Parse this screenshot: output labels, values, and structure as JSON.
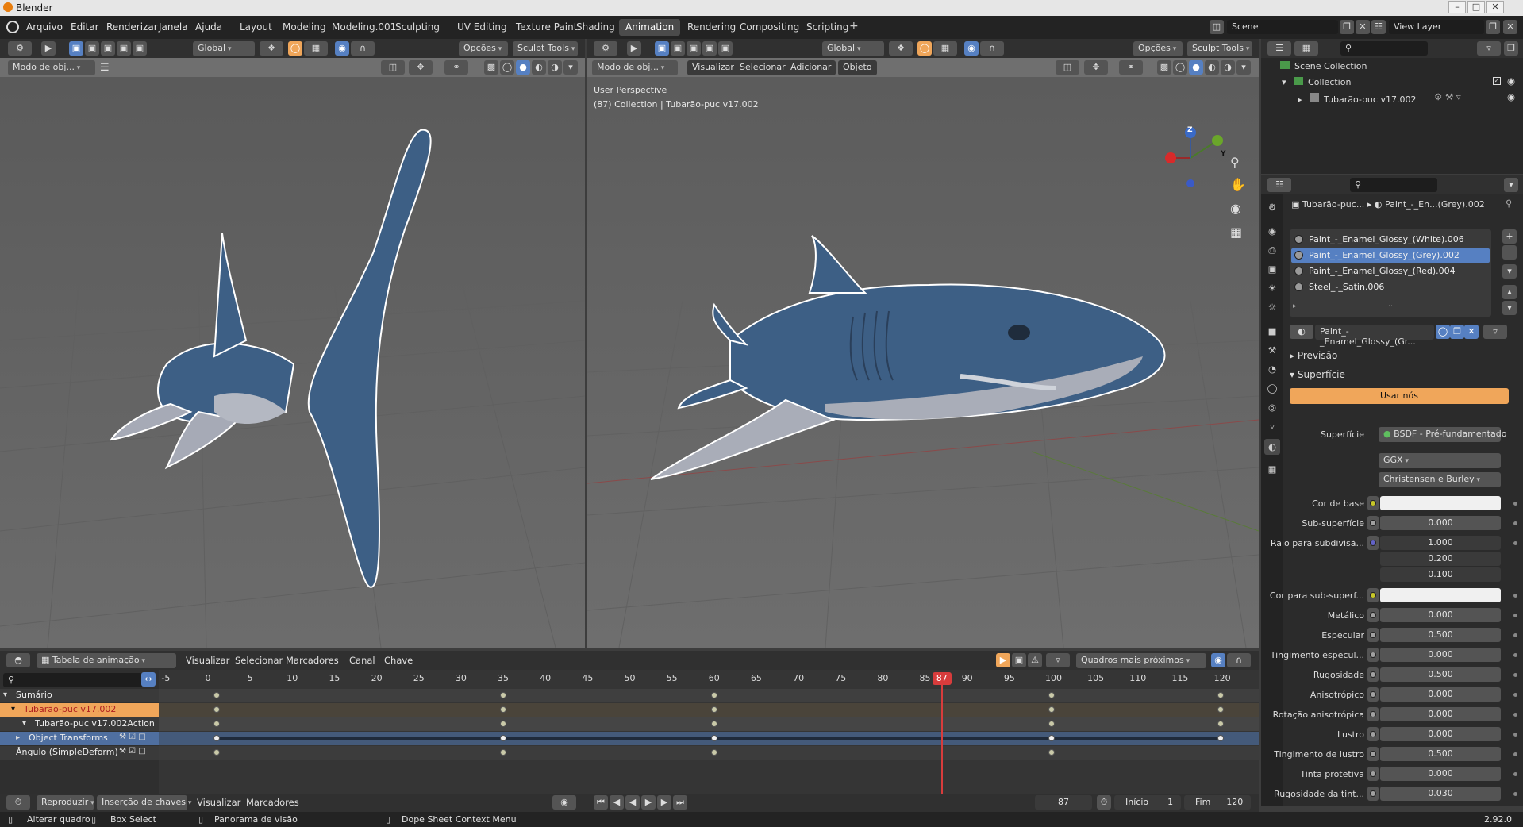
{
  "app": {
    "title": "Blender",
    "version": "2.92.0"
  },
  "menu": [
    "Arquivo",
    "Editar",
    "Renderizar",
    "Janela",
    "Ajuda"
  ],
  "workspaces": [
    "Layout",
    "Modeling",
    "Modeling.001",
    "Sculpting",
    "UV Editing",
    "Texture Paint",
    "Shading",
    "Animation",
    "Rendering",
    "Compositing",
    "Scripting"
  ],
  "active_workspace": "Animation",
  "scene": {
    "name": "Scene",
    "view_layer": "View Layer"
  },
  "toolbar": {
    "transform_orientation": "Global",
    "options": "Opções",
    "sculpt_tools": "Sculpt Tools"
  },
  "viewport_left": {
    "mode": "Modo de obj..."
  },
  "viewport_right": {
    "mode": "Modo de obj...",
    "menus": [
      "Visualizar",
      "Selecionar",
      "Adicionar",
      "Objeto"
    ],
    "info_line1": "User Perspective",
    "info_line2": "(87) Collection | Tubarão-puc v17.002",
    "gizmo": {
      "z": "Z",
      "y": "Y"
    }
  },
  "colors": {
    "accent_blue": "#5680c2",
    "active_orange": "#f0a65a",
    "timeline_red": "#d83c3c",
    "shark_blue": "#3d5f85",
    "viewport_bg": "#6f6f6f"
  },
  "outliner": {
    "scene_collection": "Scene Collection",
    "collection": "Collection",
    "object": "Tubarão-puc v17.002"
  },
  "properties": {
    "breadcrumb_object": "Tubarão-puc...",
    "breadcrumb_material": "Paint_-_En...(Grey).002",
    "materials": [
      "Paint_-_Enamel_Glossy_(White).006",
      "Paint_-_Enamel_Glossy_(Grey).002",
      "Paint_-_Enamel_Glossy_(Red).004",
      "Steel_-_Satin.006"
    ],
    "selected_material_index": 1,
    "material_field": "Paint_-_Enamel_Glossy_(Gr...",
    "sections": {
      "preview": "Previsão",
      "surface": "Superfície"
    },
    "use_nodes": "Usar nós",
    "surface_label": "Superfície",
    "surface_value": "BSDF - Pré-fundamentado",
    "distribution": "GGX",
    "subsurface_method": "Christensen e Burley",
    "fields": [
      {
        "label": "Cor de base",
        "value": "",
        "kind": "color",
        "sock": "y"
      },
      {
        "label": "Sub-superfície",
        "value": "0.000",
        "kind": "num",
        "sock": "g"
      },
      {
        "label": "Raio para subdivisã...",
        "value": "1.000",
        "kind": "vec",
        "sock": "b"
      },
      {
        "label": "",
        "value": "0.200",
        "kind": "vec2",
        "sock": ""
      },
      {
        "label": "",
        "value": "0.100",
        "kind": "vec3",
        "sock": ""
      },
      {
        "label": "Cor para sub-superf...",
        "value": "",
        "kind": "color",
        "sock": "y"
      },
      {
        "label": "Metálico",
        "value": "0.000",
        "kind": "num",
        "sock": "g"
      },
      {
        "label": "Especular",
        "value": "0.500",
        "kind": "num",
        "sock": "g"
      },
      {
        "label": "Tingimento especul...",
        "value": "0.000",
        "kind": "num",
        "sock": "g"
      },
      {
        "label": "Rugosidade",
        "value": "0.500",
        "kind": "num",
        "sock": "g"
      },
      {
        "label": "Anisotrópico",
        "value": "0.000",
        "kind": "num",
        "sock": "g"
      },
      {
        "label": "Rotação anisotrópica",
        "value": "0.000",
        "kind": "num",
        "sock": "g"
      },
      {
        "label": "Lustro",
        "value": "0.000",
        "kind": "num",
        "sock": "g"
      },
      {
        "label": "Tingimento de lustro",
        "value": "0.500",
        "kind": "num",
        "sock": "g"
      },
      {
        "label": "Tinta protetiva",
        "value": "0.000",
        "kind": "num",
        "sock": "g"
      },
      {
        "label": "Rugosidade da tint...",
        "value": "0.030",
        "kind": "num",
        "sock": "g"
      }
    ]
  },
  "dopesheet": {
    "mode": "Tabela de animação",
    "menus": [
      "Visualizar",
      "Selecionar",
      "Marcadores",
      "Canal",
      "Chave"
    ],
    "snap": "Quadros mais próximos",
    "frame_ticks": [
      "-5",
      "0",
      "5",
      "10",
      "15",
      "20",
      "25",
      "30",
      "35",
      "40",
      "45",
      "50",
      "55",
      "60",
      "65",
      "70",
      "75",
      "80",
      "85",
      "90",
      "95",
      "100",
      "105",
      "110",
      "115",
      "120"
    ],
    "current_frame": "87",
    "channels": [
      "Sumário",
      "Tubarão-puc v17.002",
      "Tubarão-puc v17.002Action",
      "Object Transforms",
      "Ângulo (SimpleDeform)"
    ],
    "keyframes": [
      1,
      35,
      60,
      100,
      120
    ]
  },
  "timeline": {
    "menus": [
      "Reproduzir",
      "Inserção de chaves",
      "Visualizar",
      "Marcadores"
    ],
    "current_frame": "87",
    "start_label": "Início",
    "start": "1",
    "end_label": "Fim",
    "end": "120"
  },
  "statusbar": [
    "Alterar quadro",
    "Box Select",
    "Panorama de visão",
    "Dope Sheet Context Menu"
  ]
}
